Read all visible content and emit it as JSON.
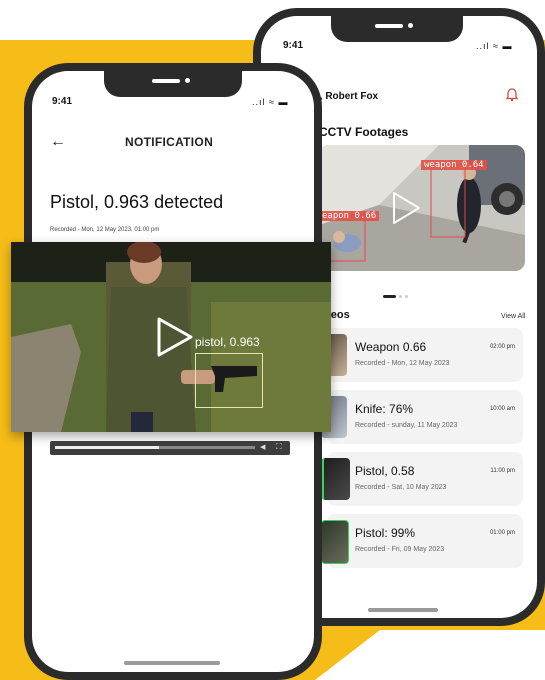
{
  "status_time": "9:41",
  "status_icons": "..ıl ≈ ▬",
  "back_phone": {
    "greeting": "i, Robert Fox",
    "cctv_title": "CCTV Footages",
    "detections": [
      {
        "label": "weapon 0.64"
      },
      {
        "label": "eapon 0.66"
      }
    ],
    "videos_title": "ideos",
    "view_all": "View All",
    "videos": [
      {
        "title": "Weapon 0.66",
        "recorded": "Recorded - Mon, 12 May 2023",
        "time": "02:00 pm"
      },
      {
        "title": "Knife: 76%",
        "recorded": "Recorded - sunday, 11 May 2023",
        "time": "10:00 am"
      },
      {
        "title": "Pistol, 0.58",
        "recorded": "Recorded - Sat, 10 May 2023",
        "time": "11:00 pm"
      },
      {
        "title": "Pistol: 99%",
        "recorded": "Recorded - Fri, 09 May 2023",
        "time": "01:00 pm"
      }
    ]
  },
  "front_phone": {
    "back_arrow": "←",
    "title": "NOTIFICATION",
    "detection_title": "Pistol, 0.963 detected",
    "recorded": "Recorded - Mon, 12 May 2023, 01:00 pm",
    "video_label": "pistol, 0.963",
    "progress": 0.52
  },
  "colors": {
    "accent": "#f6bd18",
    "detection": "#e04848",
    "bell": "#e0443a"
  }
}
